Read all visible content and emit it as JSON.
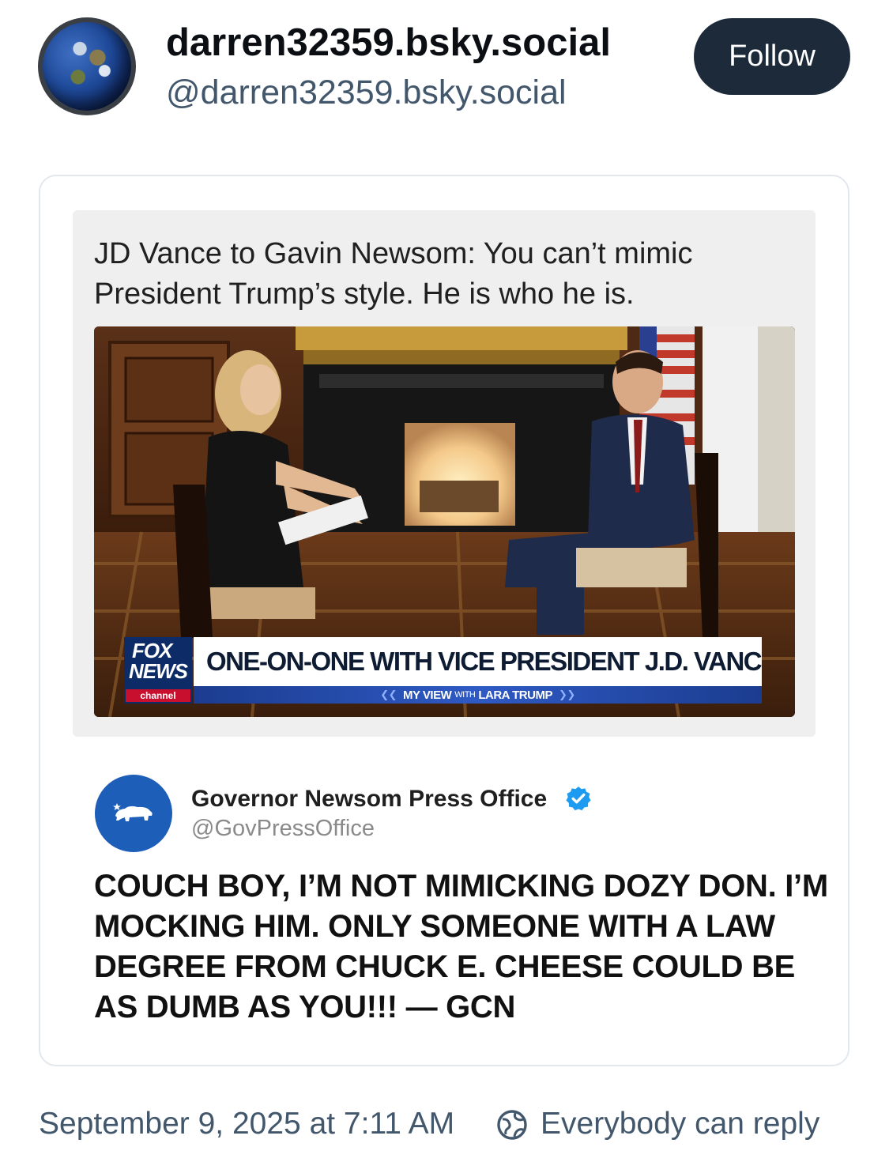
{
  "author": {
    "display_name": "darren32359.bsky.social",
    "handle": "@darren32359.bsky.social",
    "follow_label": "Follow"
  },
  "embed": {
    "headline": "JD Vance to Gavin Newsom: You can’t mimic President Trump’s style. He is who he is.",
    "video_still": {
      "network_logo": {
        "line1": "FOX",
        "line2": "NEWS",
        "line3": "channel"
      },
      "chyron_main": "ONE-ON-ONE WITH VICE PRESIDENT J.D. VANCE",
      "chyron_show": "MY VIEW",
      "chyron_with": "WITH",
      "chyron_host": "LARA TRUMP"
    },
    "quoted_tweet": {
      "name": "Governor Newsom Press Office",
      "handle": "@GovPressOffice",
      "verified": true,
      "text": "COUCH BOY, I’M NOT MIMICKING DOZY DON. I’M MOCKING HIM. ONLY SOMEONE WITH A LAW DEGREE FROM CHUCK E. CHEESE COULD BE AS DUMB AS YOU!!! — GCN"
    }
  },
  "footer": {
    "timestamp": "September 9, 2025 at 7:11 AM",
    "reply_setting": "Everybody can reply"
  },
  "colors": {
    "follow_button_bg": "#1c2a3a",
    "secondary_text": "#42576c",
    "verified_badge": "#1d9bf0",
    "card_border": "#e3e8ee"
  },
  "icons": {
    "avatar": "earth-globe",
    "verified": "verified-check-icon",
    "reply": "globe-reply-icon"
  }
}
